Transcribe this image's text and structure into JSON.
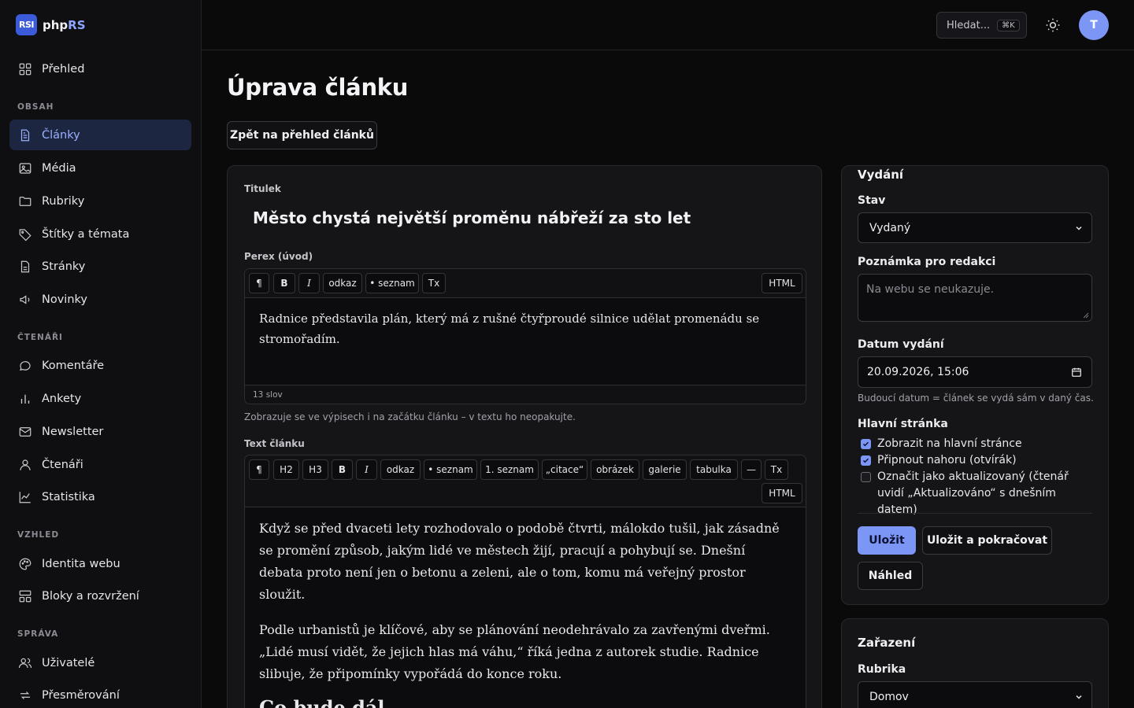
{
  "brand": {
    "logo": "RSI",
    "name_a": "php",
    "name_b": "RS"
  },
  "sidebar": {
    "top_item": {
      "label": "Přehled",
      "icon": "dashboard-icon"
    },
    "sections": [
      {
        "title": "OBSAH",
        "items": [
          {
            "label": "Články",
            "icon": "document-icon",
            "active": true
          },
          {
            "label": "Média",
            "icon": "image-icon"
          },
          {
            "label": "Rubriky",
            "icon": "folder-icon"
          },
          {
            "label": "Štítky a témata",
            "icon": "tag-icon"
          },
          {
            "label": "Stránky",
            "icon": "page-icon"
          },
          {
            "label": "Novinky",
            "icon": "megaphone-icon"
          }
        ]
      },
      {
        "title": "ČTENÁŘI",
        "items": [
          {
            "label": "Komentáře",
            "icon": "comment-icon"
          },
          {
            "label": "Ankety",
            "icon": "bar-chart-icon"
          },
          {
            "label": "Newsletter",
            "icon": "mail-icon"
          },
          {
            "label": "Čtenáři",
            "icon": "user-icon"
          },
          {
            "label": "Statistika",
            "icon": "line-chart-icon"
          }
        ]
      },
      {
        "title": "VZHLED",
        "items": [
          {
            "label": "Identita webu",
            "icon": "palette-icon"
          },
          {
            "label": "Bloky a rozvržení",
            "icon": "layout-icon"
          }
        ]
      },
      {
        "title": "SPRÁVA",
        "items": [
          {
            "label": "Uživatelé",
            "icon": "users-icon"
          },
          {
            "label": "Přesměrování",
            "icon": "redirect-icon"
          }
        ]
      }
    ]
  },
  "topbar": {
    "search_label": "Hledat...",
    "search_shortcut": "⌘K",
    "avatar_initial": "T"
  },
  "page": {
    "title": "Úprava článku",
    "back_label": "Zpět na přehled článků"
  },
  "editor": {
    "title_label": "Titulek",
    "title_value": "Město chystá největší proměnu nábřeží za sto let",
    "perex_label": "Perex (úvod)",
    "perex_toolbar": [
      "¶",
      "B",
      "I",
      "odkaz",
      "• seznam",
      "Tx"
    ],
    "perex_html_label": "HTML",
    "perex_text": "Radnice představila plán, který má z rušné čtyřproudé silnice udělat promenádu se stromořadím.",
    "perex_word_count": "13 slov",
    "perex_hint": "Zobrazuje se ve výpisech i na začátku článku – v textu ho neopakujte.",
    "body_label": "Text článku",
    "body_toolbar": [
      "¶",
      "H2",
      "H3",
      "B",
      "I",
      "odkaz",
      "• seznam",
      "1. seznam",
      "„citace“",
      "obrázek",
      "galerie",
      "tabulka",
      "—",
      "Tx"
    ],
    "body_html_label": "HTML",
    "body_p1": "Když se před dvaceti lety rozhodovalo o podobě čtvrti, málokdo tušil, jak zásadně se promění způsob, jakým lidé ve městech žijí, pracují a pohybují se. Dnešní debata proto není jen o betonu a zeleni, ale o tom, komu má veřejný prostor sloužit.",
    "body_p2": "Podle urbanistů je klíčové, aby se plánování neodehrávalo za zavřenými dveřmi. „Lidé musí vidět, že jejich hlas má váhu,“ říká jedna z autorek studie. Radnice slibuje, že připomínky vypořádá do konce roku.",
    "body_h2": "Co bude dál"
  },
  "publish": {
    "title": "Vydání",
    "status_label": "Stav",
    "status_value": "Vydaný",
    "note_label": "Poznámka pro redakci",
    "note_placeholder": "Na webu se neukazuje.",
    "date_label": "Datum vydání",
    "date_value": "20.09.2026, 15:06",
    "date_hint": "Budoucí datum = článek se vydá sám v daný čas.",
    "homepage_label": "Hlavní stránka",
    "checks": [
      {
        "label": "Zobrazit na hlavní stránce",
        "checked": true
      },
      {
        "label": "Připnout nahoru (otvírák)",
        "checked": true
      },
      {
        "label": "Označit jako aktualizovaný (čtenář uvidí „Aktualizováno“ s dnešním datem)",
        "checked": false
      }
    ],
    "save_label": "Uložit",
    "save_continue_label": "Uložit a pokračovat",
    "preview_label": "Náhled"
  },
  "classification": {
    "title": "Zařazení",
    "category_label": "Rubrika",
    "category_value": "Domov"
  },
  "colors": {
    "accent": "#7c96f5",
    "active_bg": "#1d2640",
    "background": "#0a0a0b"
  }
}
